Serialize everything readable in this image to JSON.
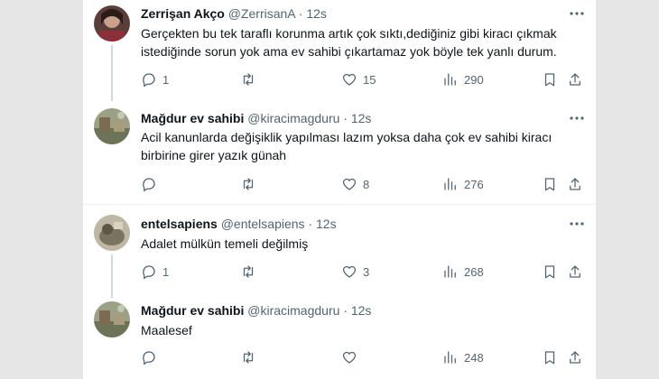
{
  "tweets": [
    {
      "name": "Zerrişan Akço",
      "handle": "@ZerrisanA",
      "time": "12s",
      "text": "Gerçekten bu tek taraflı korunma artık çok sıktı,dediğiniz gibi kiracı çıkmak istediğinde sorun yok ama ev sahibi çıkartamaz yok böyle tek yanlı durum.",
      "replies": "1",
      "retweets": "",
      "likes": "15",
      "views": "290"
    },
    {
      "name": "Mağdur ev sahibi",
      "handle": "@kiracimagduru",
      "time": "12s",
      "text": "Acil kanunlarda değişiklik yapılması lazım yoksa daha çok ev sahibi kiracı birbirine girer yazık günah",
      "replies": "",
      "retweets": "",
      "likes": "8",
      "views": "276"
    },
    {
      "name": "entelsapiens",
      "handle": "@entelsapiens",
      "time": "12s",
      "text": "Adalet mülkün temeli değilmiş",
      "replies": "1",
      "retweets": "",
      "likes": "3",
      "views": "268"
    },
    {
      "name": "Mağdur ev sahibi",
      "handle": "@kiracimagduru",
      "time": "12s",
      "text": "Maalesef",
      "replies": "",
      "retweets": "",
      "likes": "",
      "views": "248"
    }
  ],
  "icons": {
    "more": "more-horizontal-icon",
    "reply": "reply-icon",
    "retweet": "retweet-icon",
    "like": "heart-icon",
    "views": "views-icon",
    "bookmark": "bookmark-icon",
    "share": "share-icon"
  },
  "colors": {
    "text": "#0f1419",
    "secondary": "#536471",
    "thread_line": "#cfd9de",
    "separator": "#eff3f4"
  }
}
